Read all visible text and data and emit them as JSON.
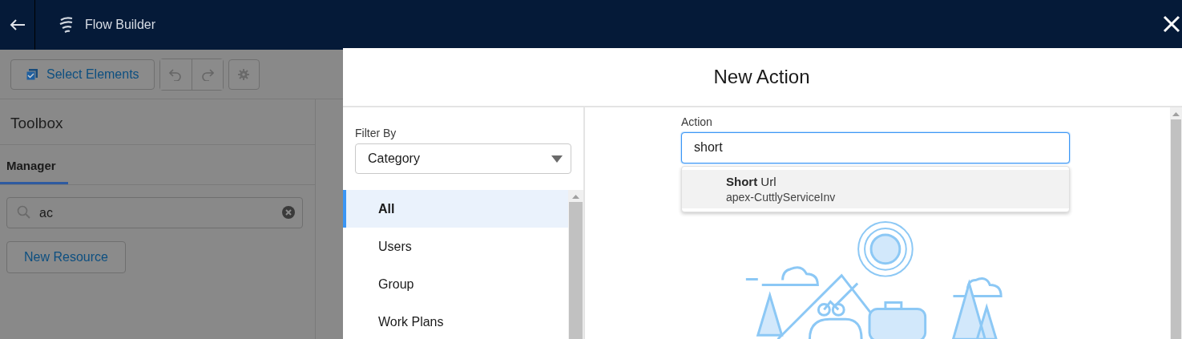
{
  "header": {
    "title": "Flow Builder"
  },
  "toolbar": {
    "select_button": "Select Elements"
  },
  "toolbox": {
    "title": "Toolbox",
    "tabs": [
      {
        "label": "Manager",
        "selected": true
      }
    ],
    "search": {
      "value": "ac"
    },
    "new_button": "New Resource"
  },
  "modal": {
    "title": "New Action",
    "filter": {
      "label": "Filter By",
      "value": "Category"
    },
    "categories": [
      {
        "label": "All",
        "selected": true
      },
      {
        "label": "Users",
        "selected": false
      },
      {
        "label": "Group",
        "selected": false
      },
      {
        "label": "Work Plans",
        "selected": false
      }
    ],
    "action": {
      "label": "Action",
      "value": "short"
    },
    "suggestions": [
      {
        "title": "**Short** Url",
        "subtitle": "apex-CuttlyServiceInv",
        "highlighted": true
      }
    ]
  }
}
